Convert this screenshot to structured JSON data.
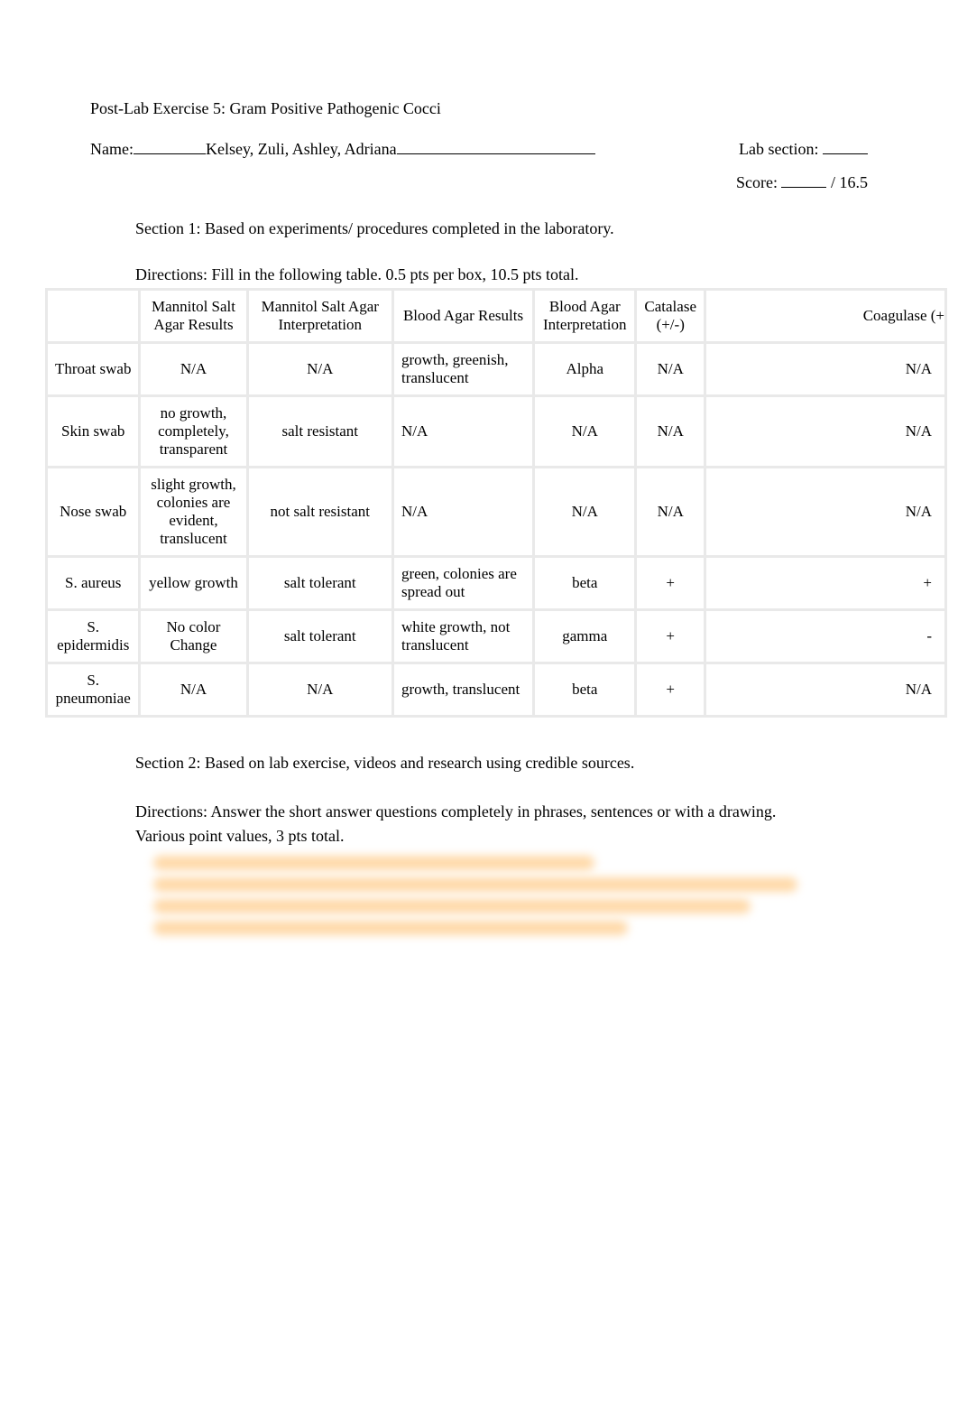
{
  "title": "Post-Lab Exercise 5: Gram Positive Pathogenic Cocci",
  "name_label": "Name:",
  "names": "Kelsey, Zuli, Ashley, Adriana",
  "lab_section_label": " Lab section: ",
  "score_label": "Score: ",
  "score_total": " / 16.5",
  "section1_heading": "Section 1: Based on experiments/ procedures completed in the laboratory.",
  "directions1": "Directions: Fill in the following table. 0.5 pts per box, 10.5 pts total.",
  "headers": {
    "blank": "",
    "msa_results": "Mannitol Salt Agar Results",
    "msa_interp": "Mannitol Salt Agar Interpretation",
    "ba_results": "Blood Agar Results",
    "ba_interp": "Blood Agar Interpretation",
    "catalase": "Catalase (+/-)",
    "coagulase": "Coagulase (+"
  },
  "rows": [
    {
      "label": "Throat swab",
      "msa_res": "N/A",
      "msa_int": "N/A",
      "ba_res": "growth, greenish, translucent",
      "ba_int": "Alpha",
      "cat": "N/A",
      "coag": "N/A"
    },
    {
      "label": "Skin swab",
      "msa_res": "no growth, completely, transparent",
      "msa_int": "salt resistant",
      "ba_res": "N/A",
      "ba_int": "N/A",
      "cat": "N/A",
      "coag": "N/A"
    },
    {
      "label": "Nose swab",
      "msa_res": "slight growth, colonies are evident, translucent",
      "msa_int": "not salt resistant",
      "ba_res": "N/A",
      "ba_int": "N/A",
      "cat": "N/A",
      "coag": "N/A"
    },
    {
      "label": "S. aureus",
      "msa_res": "yellow growth",
      "msa_int": "salt tolerant",
      "ba_res": "green, colonies are spread out",
      "ba_int": "beta",
      "cat": "+",
      "coag": "+"
    },
    {
      "label": "S. epidermidis",
      "msa_res": "No color Change",
      "msa_int": "salt tolerant",
      "ba_res": "white growth, not translucent",
      "ba_int": "gamma",
      "cat": "+",
      "coag": "-"
    },
    {
      "label": "S. pneumoniae",
      "msa_res": "N/A",
      "msa_int": "N/A",
      "ba_res": "growth, translucent",
      "ba_int": "beta",
      "cat": "+",
      "coag": "N/A"
    }
  ],
  "section2_heading": "Section 2: Based on lab exercise, videos and research using credible sources.",
  "directions2": "Directions: Answer the short answer questions completely in phrases, sentences or with a drawing. Various point values, 3 pts total."
}
